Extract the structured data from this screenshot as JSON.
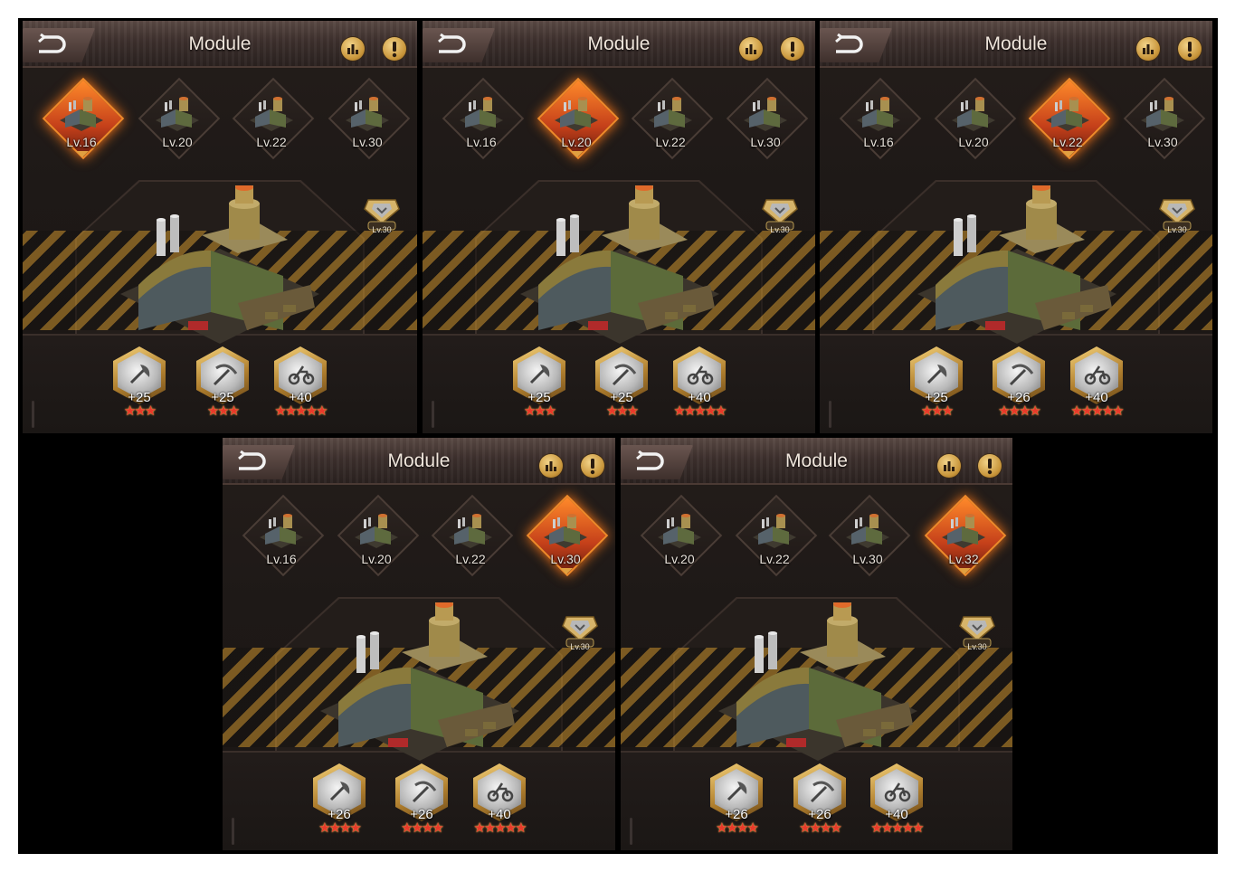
{
  "panels": [
    {
      "title": "Module",
      "tiers": [
        "Lv.16",
        "Lv.20",
        "Lv.22",
        "Lv.30"
      ],
      "selected_tier": 0,
      "badge": "Lv.30",
      "modules": [
        {
          "icon": "axe-icon",
          "bonus": "+25",
          "stars": "★★★"
        },
        {
          "icon": "pickaxe-icon",
          "bonus": "+25",
          "stars": "★★★"
        },
        {
          "icon": "motorcycle-icon",
          "bonus": "+40",
          "stars": "★★★★★"
        }
      ]
    },
    {
      "title": "Module",
      "tiers": [
        "Lv.16",
        "Lv.20",
        "Lv.22",
        "Lv.30"
      ],
      "selected_tier": 1,
      "badge": "Lv.30",
      "modules": [
        {
          "icon": "axe-icon",
          "bonus": "+25",
          "stars": "★★★"
        },
        {
          "icon": "pickaxe-icon",
          "bonus": "+25",
          "stars": "★★★"
        },
        {
          "icon": "motorcycle-icon",
          "bonus": "+40",
          "stars": "★★★★★"
        }
      ]
    },
    {
      "title": "Module",
      "tiers": [
        "Lv.16",
        "Lv.20",
        "Lv.22",
        "Lv.30"
      ],
      "selected_tier": 2,
      "badge": "Lv.30",
      "modules": [
        {
          "icon": "axe-icon",
          "bonus": "+25",
          "stars": "★★★"
        },
        {
          "icon": "pickaxe-icon",
          "bonus": "+26",
          "stars": "★★★★"
        },
        {
          "icon": "motorcycle-icon",
          "bonus": "+40",
          "stars": "★★★★★"
        }
      ]
    },
    {
      "title": "Module",
      "tiers": [
        "Lv.16",
        "Lv.20",
        "Lv.22",
        "Lv.30"
      ],
      "selected_tier": 3,
      "badge": "Lv.30",
      "modules": [
        {
          "icon": "axe-icon",
          "bonus": "+26",
          "stars": "★★★★"
        },
        {
          "icon": "pickaxe-icon",
          "bonus": "+26",
          "stars": "★★★★"
        },
        {
          "icon": "motorcycle-icon",
          "bonus": "+40",
          "stars": "★★★★★"
        }
      ]
    },
    {
      "title": "Module",
      "tiers": [
        "Lv.20",
        "Lv.22",
        "Lv.30",
        "Lv.32"
      ],
      "selected_tier": 3,
      "badge": "Lv.30",
      "modules": [
        {
          "icon": "axe-icon",
          "bonus": "+26",
          "stars": "★★★★"
        },
        {
          "icon": "pickaxe-icon",
          "bonus": "+26",
          "stars": "★★★★"
        },
        {
          "icon": "motorcycle-icon",
          "bonus": "+40",
          "stars": "★★★★★"
        }
      ]
    }
  ],
  "colors": {
    "selected_glow": "#ff7a1a",
    "star_red": "#e83a2a",
    "button_gold": "#c8953a"
  }
}
